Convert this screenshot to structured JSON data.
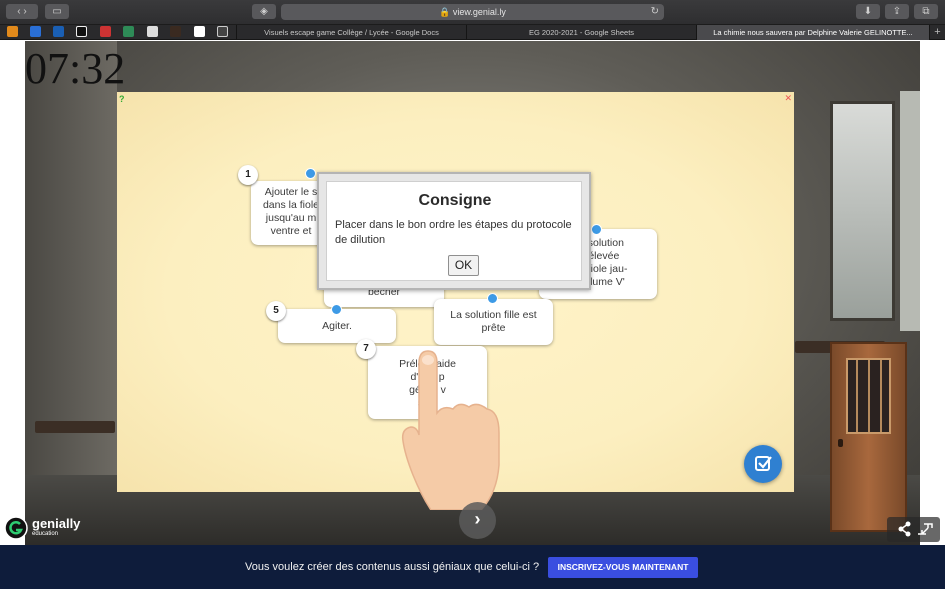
{
  "browser": {
    "url": "view.genial.ly",
    "tabs": [
      "Visuels escape game Collège / Lycée - Google Docs",
      "EG 2020-2021 - Google Sheets",
      "La chimie nous sauvera par Delphine Valerie GELINOTTE..."
    ],
    "new_tab_label": "+"
  },
  "timer": "07:32",
  "steps": [
    {
      "number": "1",
      "text": "Ajouter le s\ndans la fiole\njusqu'au m\nventre et"
    },
    {
      "number": "",
      "text": "a solution\nprélevée\ne fiole jau-\nvolume V'"
    },
    {
      "number": "",
      "text": "bécher"
    },
    {
      "number": "5",
      "text": "Agiter."
    },
    {
      "number": "",
      "text": "La solution fille est\nprête"
    },
    {
      "number": "7",
      "text": "Prélev      l'aide\nd'une p\ngée le v\nsolu"
    }
  ],
  "modal": {
    "title": "Consigne",
    "text": "Placer dans le bon ordre les étapes du protocole de dilution",
    "ok_label": "OK"
  },
  "brand": {
    "name": "genially",
    "sub": "education"
  },
  "banner": {
    "text": "Vous voulez créer des contenus aussi géniaux que celui-ci ?",
    "cta": "INSCRIVEZ-VOUS MAINTENANT"
  },
  "icons": {
    "help": "help-icon",
    "close": "close-icon",
    "validate": "check-validate-icon",
    "next": "chevron-right-icon",
    "share": "share-icon",
    "fullscreen": "fullscreen-icon"
  }
}
